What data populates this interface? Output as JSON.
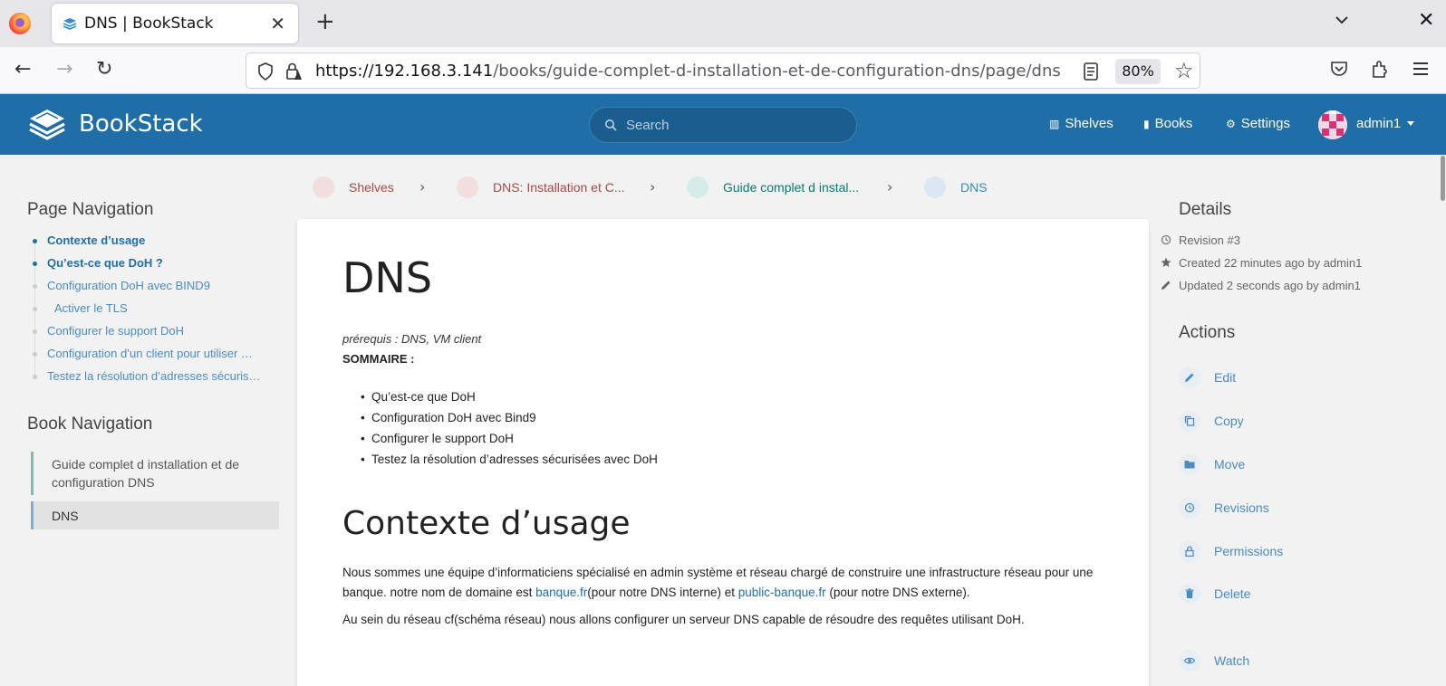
{
  "browser": {
    "tab_title": "DNS | BookStack",
    "url_host": "https://192.168.3.141",
    "url_path": "/books/guide-complet-d-installation-et-de-configuration-dns/page/dns",
    "zoom": "80%"
  },
  "header": {
    "app_name": "BookStack",
    "search_placeholder": "Search",
    "nav": {
      "shelves": "Shelves",
      "books": "Books",
      "settings": "Settings"
    },
    "user": "admin1",
    "color": "#206ea7"
  },
  "breadcrumbs": [
    {
      "label": "Shelves",
      "color": "#a94747"
    },
    {
      "label": "DNS: Installation et C...",
      "color": "#a94747"
    },
    {
      "label": "Guide complet d instal...",
      "color": "#077b70"
    },
    {
      "label": "DNS",
      "color": "#2a8fc5"
    }
  ],
  "page_navigation": {
    "title": "Page Navigation",
    "items": [
      {
        "label": "Contexte d’usage"
      },
      {
        "label": "Qu’est-ce que DoH ?"
      },
      {
        "label": "Configuration DoH avec BIND9"
      },
      {
        "label": "Activer le TLS"
      },
      {
        "label": "Configurer le support DoH"
      },
      {
        "label": "Configuration d’un client pour utiliser …"
      },
      {
        "label": "Testez la résolution d’adresses sécuris…"
      }
    ]
  },
  "book_navigation": {
    "title": "Book Navigation",
    "book": "Guide complet d installation et de configuration DNS",
    "page": "DNS"
  },
  "content": {
    "title": "DNS",
    "prereq": "prérequis : DNS, VM client",
    "sommaire": "SOMMAIRE :",
    "toc": [
      "Qu’est-ce que DoH",
      "Configuration DoH avec Bind9",
      "Configurer le support DoH",
      "Testez la résolution d’adresses sécurisées avec DoH"
    ],
    "h2": "Contexte d’usage",
    "para1_a": "Nous sommes une équipe d’informaticiens spécialisé en admin système et réseau chargé de construire une infrastructure réseau pour une banque. notre nom de domaine est ",
    "para1_link1": "banque.fr",
    "para1_b": "(pour notre DNS interne) et ",
    "para1_link2": "public-banque.fr",
    "para1_c": " (pour notre DNS externe).",
    "para2": "Au sein du réseau cf(schéma réseau) nous allons configurer un serveur DNS capable de résoudre des requêtes utilisant DoH."
  },
  "details": {
    "title": "Details",
    "revision": "Revision #3",
    "created": "Created 22 minutes ago by admin1",
    "updated": "Updated 2 seconds ago by admin1"
  },
  "actions": {
    "title": "Actions",
    "edit": "Edit",
    "copy": "Copy",
    "move": "Move",
    "revisions": "Revisions",
    "permissions": "Permissions",
    "delete": "Delete",
    "watch": "Watch"
  }
}
